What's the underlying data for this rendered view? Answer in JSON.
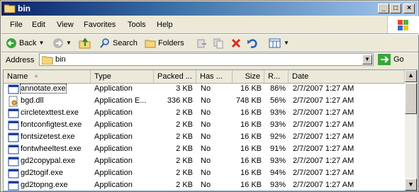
{
  "window": {
    "title": "bin"
  },
  "menu": [
    "File",
    "Edit",
    "View",
    "Favorites",
    "Tools",
    "Help"
  ],
  "toolbar": {
    "back_label": "Back",
    "search_label": "Search",
    "folders_label": "Folders"
  },
  "address": {
    "label": "Address",
    "value": "bin",
    "go_label": "Go"
  },
  "columns": [
    "Name",
    "Type",
    "Packed ...",
    "Has ...",
    "Size",
    "R...",
    "Date"
  ],
  "files": [
    {
      "name": "annotate.exe",
      "type": "Application",
      "packed": "3 KB",
      "has": "No",
      "size": "16 KB",
      "ratio": "86%",
      "date": "2/7/2007 1:27 AM",
      "icon": "exe-icon"
    },
    {
      "name": "bgd.dll",
      "type": "Application E...",
      "packed": "336 KB",
      "has": "No",
      "size": "748 KB",
      "ratio": "56%",
      "date": "2/7/2007 1:27 AM",
      "icon": "dll-icon"
    },
    {
      "name": "circletexttest.exe",
      "type": "Application",
      "packed": "2 KB",
      "has": "No",
      "size": "16 KB",
      "ratio": "93%",
      "date": "2/7/2007 1:27 AM",
      "icon": "exe-icon"
    },
    {
      "name": "fontconfigtest.exe",
      "type": "Application",
      "packed": "2 KB",
      "has": "No",
      "size": "16 KB",
      "ratio": "93%",
      "date": "2/7/2007 1:27 AM",
      "icon": "exe-icon"
    },
    {
      "name": "fontsizetest.exe",
      "type": "Application",
      "packed": "2 KB",
      "has": "No",
      "size": "16 KB",
      "ratio": "92%",
      "date": "2/7/2007 1:27 AM",
      "icon": "exe-icon"
    },
    {
      "name": "fontwheeltest.exe",
      "type": "Application",
      "packed": "2 KB",
      "has": "No",
      "size": "16 KB",
      "ratio": "91%",
      "date": "2/7/2007 1:27 AM",
      "icon": "exe-icon"
    },
    {
      "name": "gd2copypal.exe",
      "type": "Application",
      "packed": "2 KB",
      "has": "No",
      "size": "16 KB",
      "ratio": "93%",
      "date": "2/7/2007 1:27 AM",
      "icon": "exe-icon"
    },
    {
      "name": "gd2togif.exe",
      "type": "Application",
      "packed": "2 KB",
      "has": "No",
      "size": "16 KB",
      "ratio": "94%",
      "date": "2/7/2007 1:27 AM",
      "icon": "exe-icon"
    },
    {
      "name": "gd2topng.exe",
      "type": "Application",
      "packed": "2 KB",
      "has": "No",
      "size": "16 KB",
      "ratio": "93%",
      "date": "2/7/2007 1:27 AM",
      "icon": "exe-icon"
    }
  ]
}
